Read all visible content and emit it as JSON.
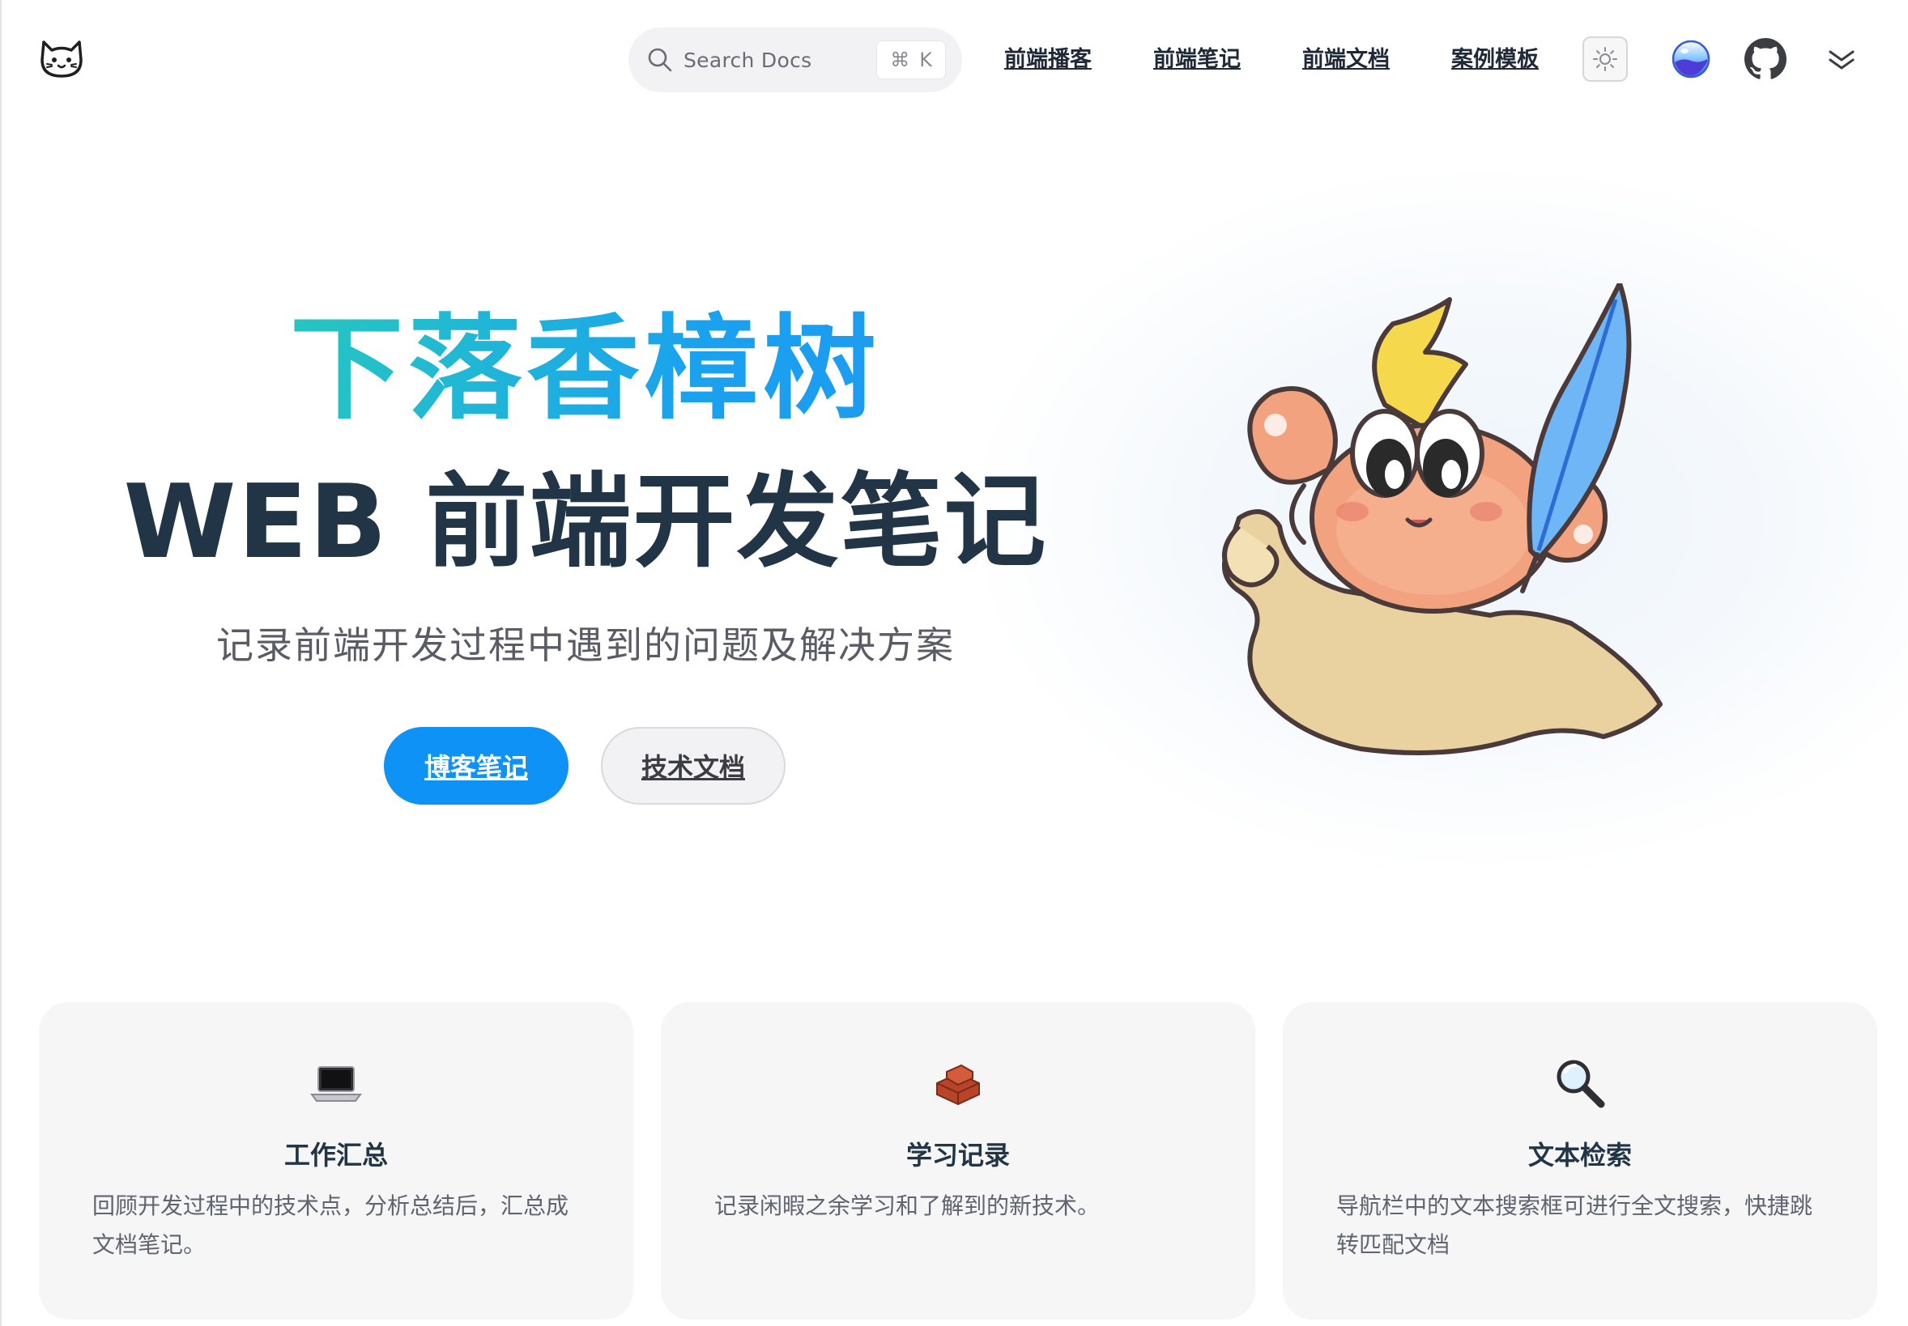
{
  "navbar": {
    "search": {
      "label": "Search Docs",
      "shortcut_symbol": "⌘",
      "shortcut_key": "K"
    },
    "links": [
      "前端播客",
      "前端笔记",
      "前端文档",
      "案例模板"
    ],
    "icons": [
      "cat-logo-icon",
      "search-icon",
      "sun-icon",
      "language-globe-icon",
      "github-icon",
      "chevron-double-down-icon"
    ]
  },
  "hero": {
    "name": "下落香樟树",
    "text": "WEB 前端开发笔记",
    "tagline": "记录前端开发过程中遇到的问题及解决方案",
    "actions": [
      {
        "label": "博客笔记",
        "theme": "brand"
      },
      {
        "label": "技术文档",
        "theme": "alt"
      }
    ]
  },
  "features": [
    {
      "icon": "laptop-icon",
      "title": "工作汇总",
      "detail": "回顾开发过程中的技术点，分析总结后，汇总成文档笔记。"
    },
    {
      "icon": "bricks-icon",
      "title": "学习记录",
      "detail": "记录闲暇之余学习和了解到的新技术。"
    },
    {
      "icon": "magnifier-icon",
      "title": "文本检索",
      "detail": "导航栏中的文本搜索框可进行全文搜索，快捷跳转匹配文档"
    }
  ],
  "colors": {
    "brand": "#0e92f5",
    "name_gradient_start": "#2fd2a0",
    "name_gradient_end": "#1f94f3",
    "text_dark": "#213547",
    "feature_bg": "#f6f6f7"
  }
}
